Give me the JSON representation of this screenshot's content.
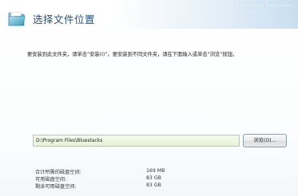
{
  "header": {
    "title": "选择文件位置",
    "brand": "Advanced Installer"
  },
  "icons": {
    "folder": "folder-icon"
  },
  "instruction": "要安装到此文件夹，请单击“安装(I)”。要安装到不同文件夹，请在下面输入或单击“浏览”按钮。",
  "path_field": {
    "value": "D:\\Program Files\\Bluestacks"
  },
  "browse_label": "浏览(O)...",
  "disk_space": [
    {
      "label": "合计所需的磁盘空间:",
      "value": "169 MB"
    },
    {
      "label": "可用磁盘空间:",
      "value": "83 GB"
    },
    {
      "label": "剩余可用磁盘空间:",
      "value": "83 GB"
    }
  ],
  "colors": {
    "title": "#1f4f86",
    "path_field_bg": "#e6f3d6"
  }
}
